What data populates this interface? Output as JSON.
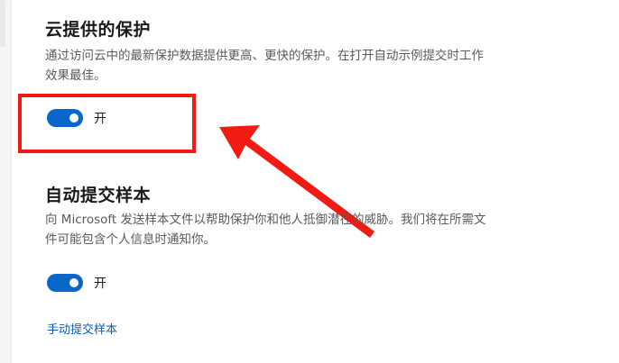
{
  "cloud_protection": {
    "title": "云提供的保护",
    "description": "通过访问云中的最新保护数据提供更高、更快的保护。在打开自动示例提交时工作效果最佳。",
    "toggle_state_label": "开",
    "toggle_on": true
  },
  "sample_submission": {
    "title": "自动提交样本",
    "description": "向 Microsoft 发送样本文件以帮助保护你和他人抵御潜在的威胁。我们将在所需文件可能包含个人信息时通知你。",
    "toggle_state_label": "开",
    "toggle_on": true,
    "manual_link": "手动提交样本"
  },
  "annotation": {
    "highlight_color": "#f01c14",
    "arrow_color": "#f01c14"
  },
  "theme": {
    "accent": "#0a67c9",
    "link": "#0a5db5"
  }
}
